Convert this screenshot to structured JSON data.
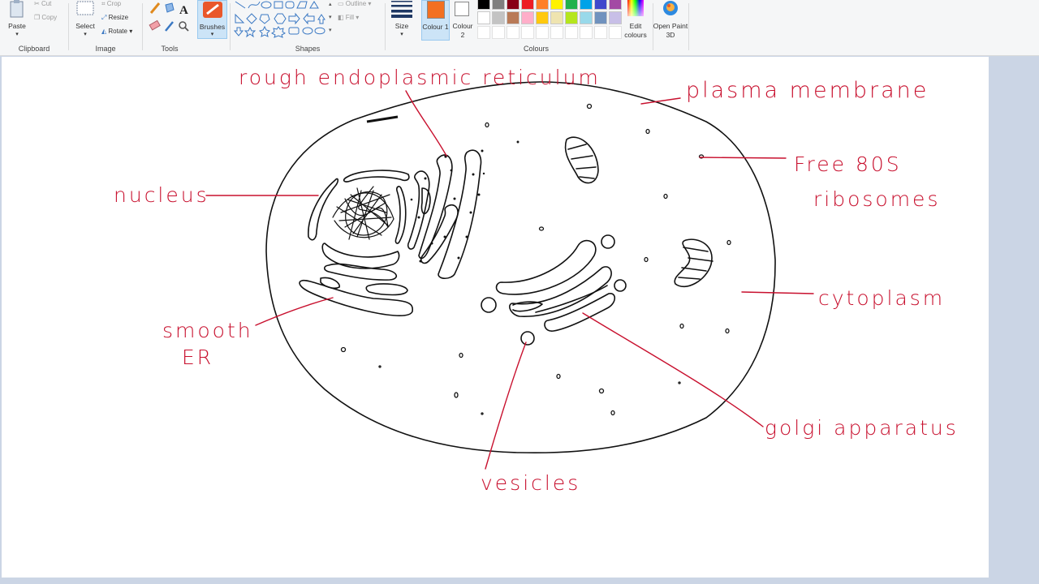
{
  "ribbon": {
    "clipboard": {
      "paste": "Paste",
      "cut": "Cut",
      "copy": "Copy",
      "group_label": "Clipboard"
    },
    "image": {
      "select": "Select",
      "crop": "Crop",
      "resize": "Resize",
      "rotate": "Rotate",
      "group_label": "Image"
    },
    "tools": {
      "group_label": "Tools"
    },
    "brushes": {
      "label": "Brushes"
    },
    "shapes": {
      "outline": "Outline",
      "fill": "Fill",
      "group_label": "Shapes"
    },
    "size": {
      "label": "Size"
    },
    "colours": {
      "colour1": "Colour 1",
      "colour2": "Colour 2",
      "edit": "Edit colours",
      "group_label": "Colours",
      "colour1_value": "#f37021",
      "colour2_value": "#ffffff",
      "palette_row1": [
        "#000000",
        "#7f7f7f",
        "#880015",
        "#ed1c24",
        "#ff7f27",
        "#fff200",
        "#22b14c",
        "#00a2e8",
        "#3f48cc",
        "#a349a4"
      ],
      "palette_row2": [
        "#ffffff",
        "#c3c3c3",
        "#b97a57",
        "#ffaec9",
        "#ffc90e",
        "#efe4b0",
        "#b5e61d",
        "#99d9ea",
        "#7092be",
        "#c8bfe7"
      ]
    },
    "paint3d": {
      "label": "Open Paint 3D"
    }
  },
  "labels": {
    "rough_er": "rough endoplasmic reticulum",
    "plasma_membrane": "plasma membrane",
    "nucleus": "nucleus",
    "free_ribosomes_1": "Free 80S",
    "free_ribosomes_2": "ribosomes",
    "cytoplasm": "cytoplasm",
    "smooth_er_1": "smooth",
    "smooth_er_2": "ER",
    "golgi": "golgi apparatus",
    "vesicles": "vesicles"
  }
}
